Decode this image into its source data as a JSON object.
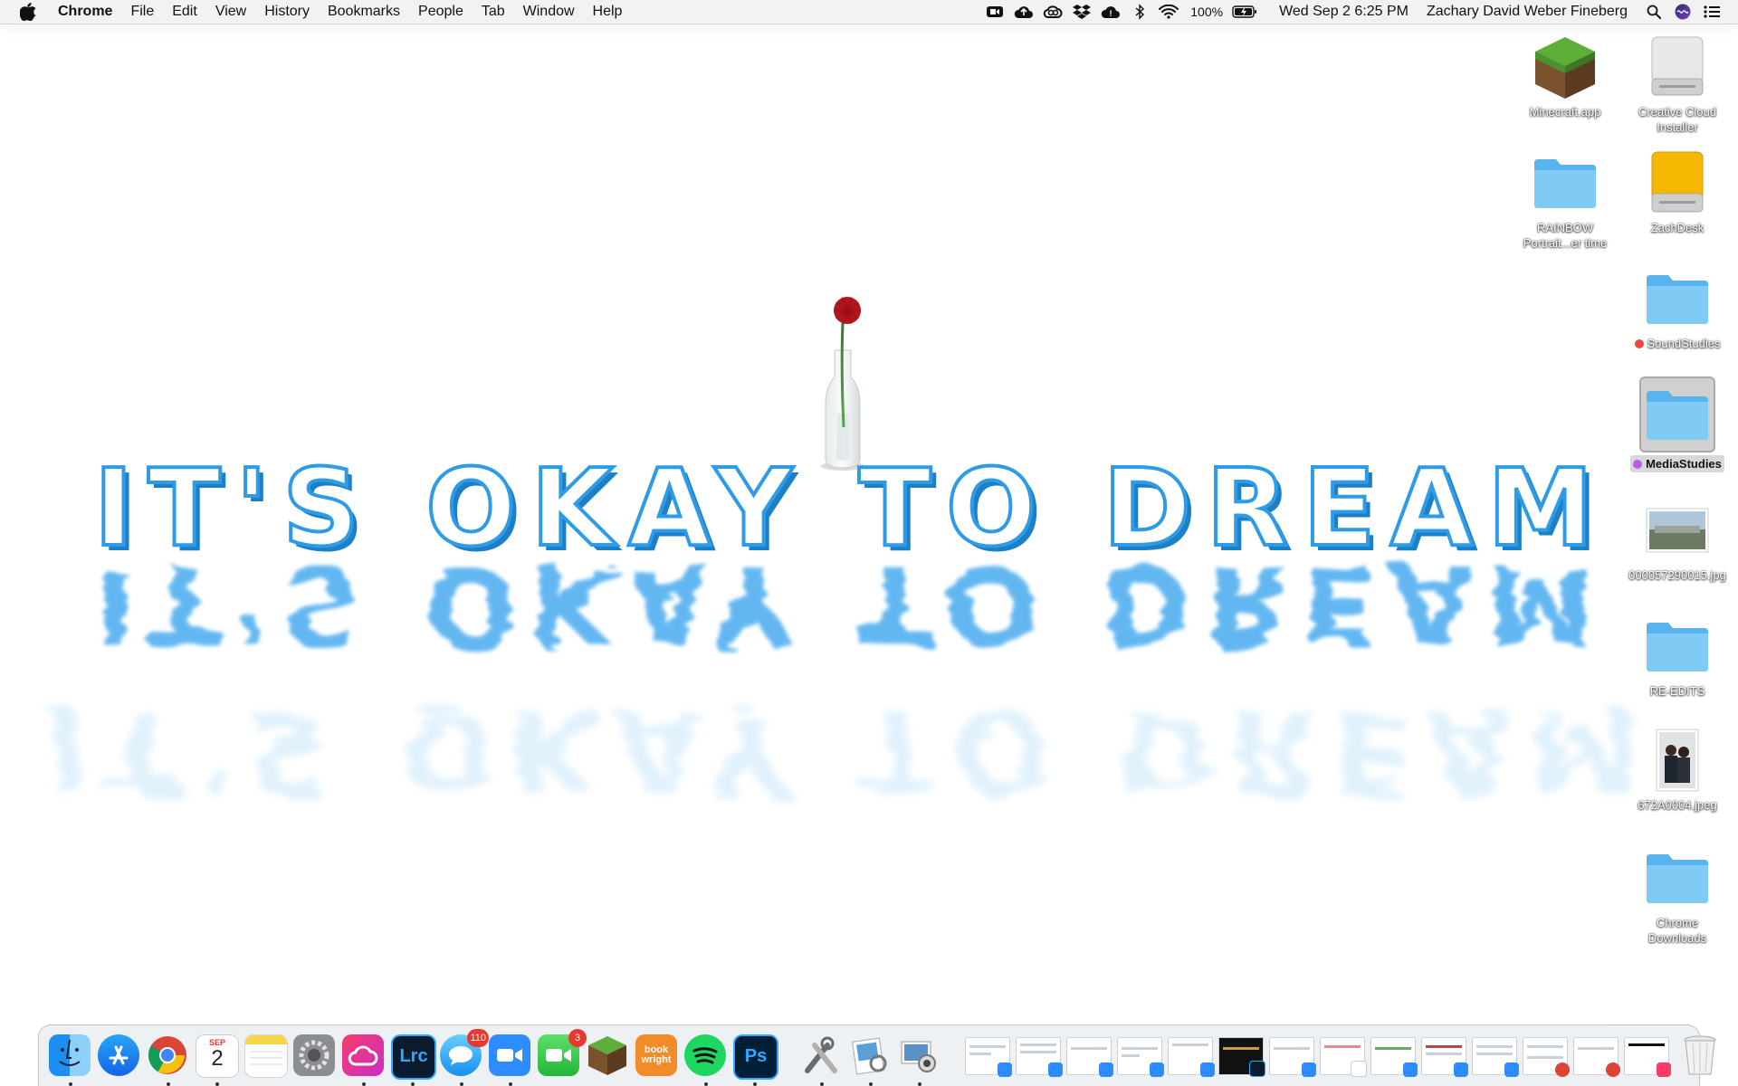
{
  "menubar": {
    "app_name": "Chrome",
    "menus": [
      "File",
      "Edit",
      "View",
      "History",
      "Bookmarks",
      "People",
      "Tab",
      "Window",
      "Help"
    ],
    "battery": "100%",
    "datetime": "Wed Sep 2  6:25 PM",
    "user": "Zachary David Weber Fineberg",
    "status_icons": [
      "zoom-icon",
      "cloud-upload-icon",
      "creative-cloud-icon",
      "dropbox-icon",
      "google-drive-icon",
      "bluetooth-icon",
      "wifi-icon",
      "battery-icon",
      "search-icon",
      "siri-icon",
      "notification-center-icon"
    ]
  },
  "wallpaper": {
    "headline": "IT'S OKAY TO DREAM",
    "accent_color": "#2e9be8"
  },
  "desktop": {
    "icons": [
      {
        "label": "Minecraft.app",
        "icon": "minecraft-icon"
      },
      {
        "label": "Creative Cloud Installer",
        "icon": "disk-image-icon"
      },
      {
        "label": "RAINBOW Portrait...er time",
        "icon": "folder-icon"
      },
      {
        "label": "ZachDesk",
        "icon": "external-drive-icon"
      },
      {
        "label": "SoundStudies",
        "icon": "folder-icon",
        "tag_color": "#f0463c"
      },
      {
        "label": "MediaStudies",
        "icon": "folder-icon",
        "tag_color": "#b65fe0",
        "selected": true
      },
      {
        "label": "000057290015.jpg",
        "icon": "photo-thumbnail-icon"
      },
      {
        "label": "RE-EDITS",
        "icon": "folder-icon"
      },
      {
        "label": "672A0004.jpeg",
        "icon": "photo-thumbnail-icon"
      },
      {
        "label": "Chrome Downloads",
        "icon": "folder-icon"
      }
    ]
  },
  "dock": {
    "apps": [
      {
        "name": "Finder",
        "icon": "finder-icon",
        "running": true
      },
      {
        "name": "App Store",
        "icon": "app-store-icon",
        "running": false
      },
      {
        "name": "Google Chrome",
        "icon": "chrome-icon",
        "running": true
      },
      {
        "name": "Calendar",
        "icon": "calendar-icon",
        "running": true,
        "month": "SEP",
        "day": "2"
      },
      {
        "name": "Notes",
        "icon": "notes-icon",
        "running": false
      },
      {
        "name": "System Preferences",
        "icon": "system-preferences-icon",
        "running": false
      },
      {
        "name": "Creative Cloud",
        "icon": "creative-cloud-icon",
        "running": true
      },
      {
        "name": "Lightroom Classic",
        "icon": "lightroom-icon",
        "running": true,
        "text": "Lrc"
      },
      {
        "name": "Messages",
        "icon": "messages-icon",
        "running": true,
        "badge": "110"
      },
      {
        "name": "Zoom",
        "icon": "zoom-icon",
        "running": true
      },
      {
        "name": "FaceTime",
        "icon": "facetime-icon",
        "running": false,
        "badge": "3"
      },
      {
        "name": "Minecraft",
        "icon": "minecraft-icon",
        "running": false
      },
      {
        "name": "BookWright",
        "icon": "bookwright-icon",
        "running": false,
        "text": "book wright"
      },
      {
        "name": "Spotify",
        "icon": "spotify-icon",
        "running": true
      },
      {
        "name": "Photoshop",
        "icon": "photoshop-icon",
        "running": true,
        "text": "Ps"
      }
    ],
    "utilities": [
      {
        "name": "Utilities",
        "icon": "utilities-icon",
        "running": true
      },
      {
        "name": "Preview",
        "icon": "preview-icon",
        "running": true
      },
      {
        "name": "Image Capture",
        "icon": "image-capture-icon",
        "running": true
      }
    ],
    "minimized_windows": 14,
    "trash": {
      "name": "Trash",
      "icon": "trash-icon"
    }
  },
  "colors": {
    "menubar_bg": "#f2f2f2",
    "folder_blue": "#6fc3f2",
    "text_blue": "#2e9be8"
  }
}
